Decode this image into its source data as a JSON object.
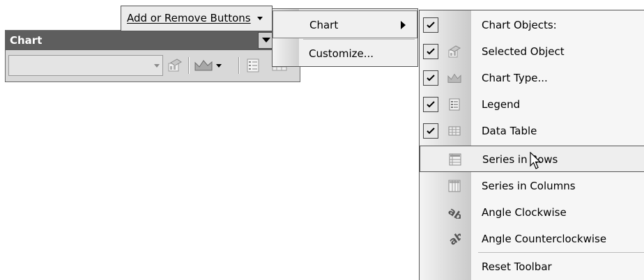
{
  "toolbar": {
    "title": "Chart",
    "chart_objects_value": ""
  },
  "add_remove": {
    "label": "Add or Remove Buttons"
  },
  "submenu1": {
    "items": [
      {
        "label": "Chart",
        "has_submenu": true,
        "highlighted": true
      },
      {
        "label": "Customize..."
      }
    ]
  },
  "submenu2": {
    "items": [
      {
        "label": "Chart Objects:",
        "checked": true,
        "icon": "none"
      },
      {
        "label": "Selected Object",
        "checked": true,
        "icon": "format-object-icon"
      },
      {
        "label": "Chart Type...",
        "checked": true,
        "icon": "chart-type-icon"
      },
      {
        "label": "Legend",
        "checked": true,
        "icon": "legend-icon"
      },
      {
        "label": "Data Table",
        "checked": true,
        "icon": "data-table-icon"
      },
      {
        "label": "Series in Rows",
        "checked": false,
        "icon": "series-rows-icon",
        "highlighted": true
      },
      {
        "label": "Series in Columns",
        "checked": false,
        "icon": "series-columns-icon"
      },
      {
        "label": "Angle Clockwise",
        "checked": false,
        "icon": "angle-clockwise-icon"
      },
      {
        "label": "Angle Counterclockwise",
        "checked": false,
        "icon": "angle-counterclockwise-icon"
      },
      {
        "label": "Reset Toolbar",
        "checked": false,
        "icon": "none"
      }
    ]
  },
  "colors": {
    "title_bar": "#5e5e5e",
    "menu_border": "#555555",
    "gutter": "#cacaca"
  }
}
